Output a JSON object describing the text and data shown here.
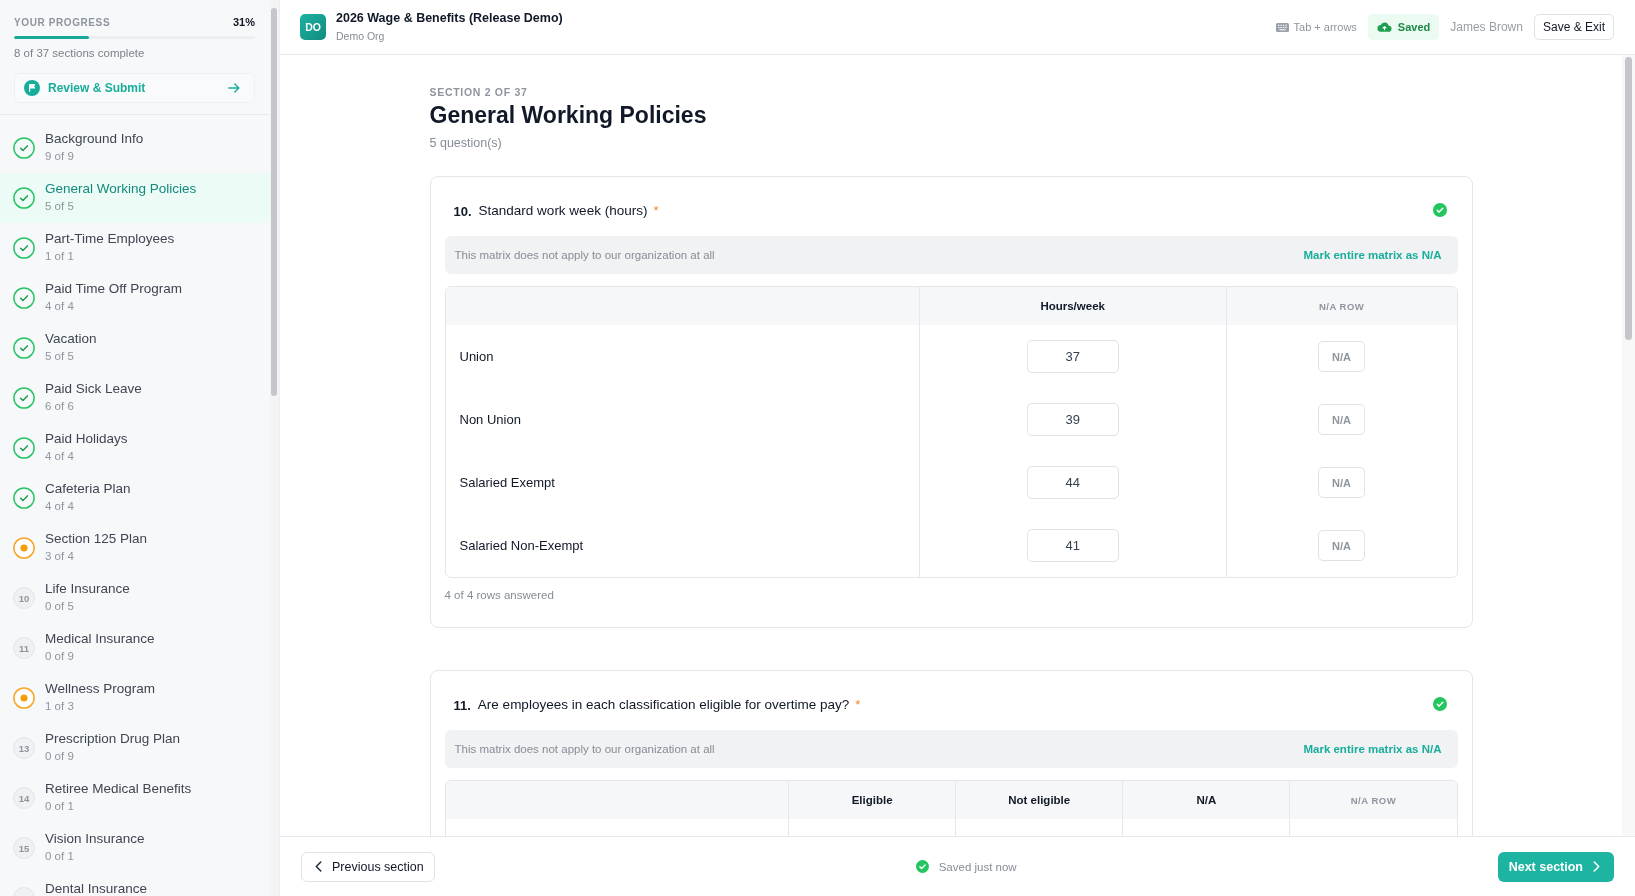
{
  "header": {
    "badge": "DO",
    "title": "2026 Wage & Benefits (Release Demo)",
    "org": "Demo Org",
    "shortcut_hint": "Tab + arrows",
    "save_status": "Saved",
    "user": "James Brown",
    "save_exit": "Save & Exit"
  },
  "sidebar": {
    "progress": {
      "label": "YOUR PROGRESS",
      "percent": "31%",
      "level": 0.31
    },
    "summary": "8 of 37 sections complete",
    "review_action": "Review & Submit",
    "sections": [
      {
        "title": "Background Info",
        "count": "9 of 9",
        "kind": "done",
        "selected": false
      },
      {
        "title": "General Working Policies",
        "count": "5 of 5",
        "kind": "done",
        "selected": true
      },
      {
        "title": "Part-Time Employees",
        "count": "1 of 1",
        "kind": "done",
        "selected": false
      },
      {
        "title": "Paid Time Off Program",
        "count": "4 of 4",
        "kind": "done",
        "selected": false
      },
      {
        "title": "Vacation",
        "count": "5 of 5",
        "kind": "done",
        "selected": false
      },
      {
        "title": "Paid Sick Leave",
        "count": "6 of 6",
        "kind": "done",
        "selected": false
      },
      {
        "title": "Paid Holidays",
        "count": "4 of 4",
        "kind": "done",
        "selected": false
      },
      {
        "title": "Cafeteria Plan",
        "count": "4 of 4",
        "kind": "done",
        "selected": false
      },
      {
        "title": "Section 125 Plan",
        "count": "3 of 4",
        "kind": "partial",
        "selected": false
      },
      {
        "title": "Life Insurance",
        "count": "0 of 5",
        "kind": "todo",
        "number": "10",
        "selected": false
      },
      {
        "title": "Medical Insurance",
        "count": "0 of 9",
        "kind": "todo",
        "number": "11",
        "selected": false
      },
      {
        "title": "Wellness Program",
        "count": "1 of 3",
        "kind": "partial",
        "selected": false
      },
      {
        "title": "Prescription Drug Plan",
        "count": "0 of 9",
        "kind": "todo",
        "number": "13",
        "selected": false
      },
      {
        "title": "Retiree Medical Benefits",
        "count": "0 of 1",
        "kind": "todo",
        "number": "14",
        "selected": false
      },
      {
        "title": "Vision Insurance",
        "count": "0 of 1",
        "kind": "todo",
        "number": "15",
        "selected": false
      },
      {
        "title": "Dental Insurance",
        "kind": "todo",
        "selected": false
      }
    ]
  },
  "section": {
    "eyebrow": "SECTION 2 OF 37",
    "title": "General Working Policies",
    "question_count": "5 question(s)"
  },
  "questions": [
    {
      "number": "10.",
      "text": "Standard work week (hours)",
      "required_mark": "*",
      "answered": true,
      "na_notice": "This matrix does not apply to our organization at all",
      "na_action": "Mark entire matrix as N/A",
      "columns": [
        "Hours/week"
      ],
      "na_column": "N/A ROW",
      "rows": [
        {
          "label": "Union",
          "value": "37",
          "na": {
            "label": "N/A",
            "selected": false
          }
        },
        {
          "label": "Non Union",
          "value": "39",
          "na": {
            "label": "N/A",
            "selected": false
          }
        },
        {
          "label": "Salaried Exempt",
          "value": "44",
          "na": {
            "label": "N/A",
            "selected": false
          }
        },
        {
          "label": "Salaried Non-Exempt",
          "value": "41",
          "na": {
            "label": "N/A",
            "selected": false
          }
        }
      ],
      "footer": "4 of 4 rows answered"
    },
    {
      "number": "11.",
      "text": "Are employees in each classification eligible for overtime pay?",
      "required_mark": "*",
      "answered": true,
      "na_notice": "This matrix does not apply to our organization at all",
      "na_action": "Mark entire matrix as N/A",
      "columns": [
        "Eligible",
        "Not eligible",
        "N/A"
      ],
      "na_column": "N/A ROW"
    }
  ],
  "footer": {
    "previous": "Previous section",
    "status": "Saved just now",
    "next": "Next section"
  }
}
